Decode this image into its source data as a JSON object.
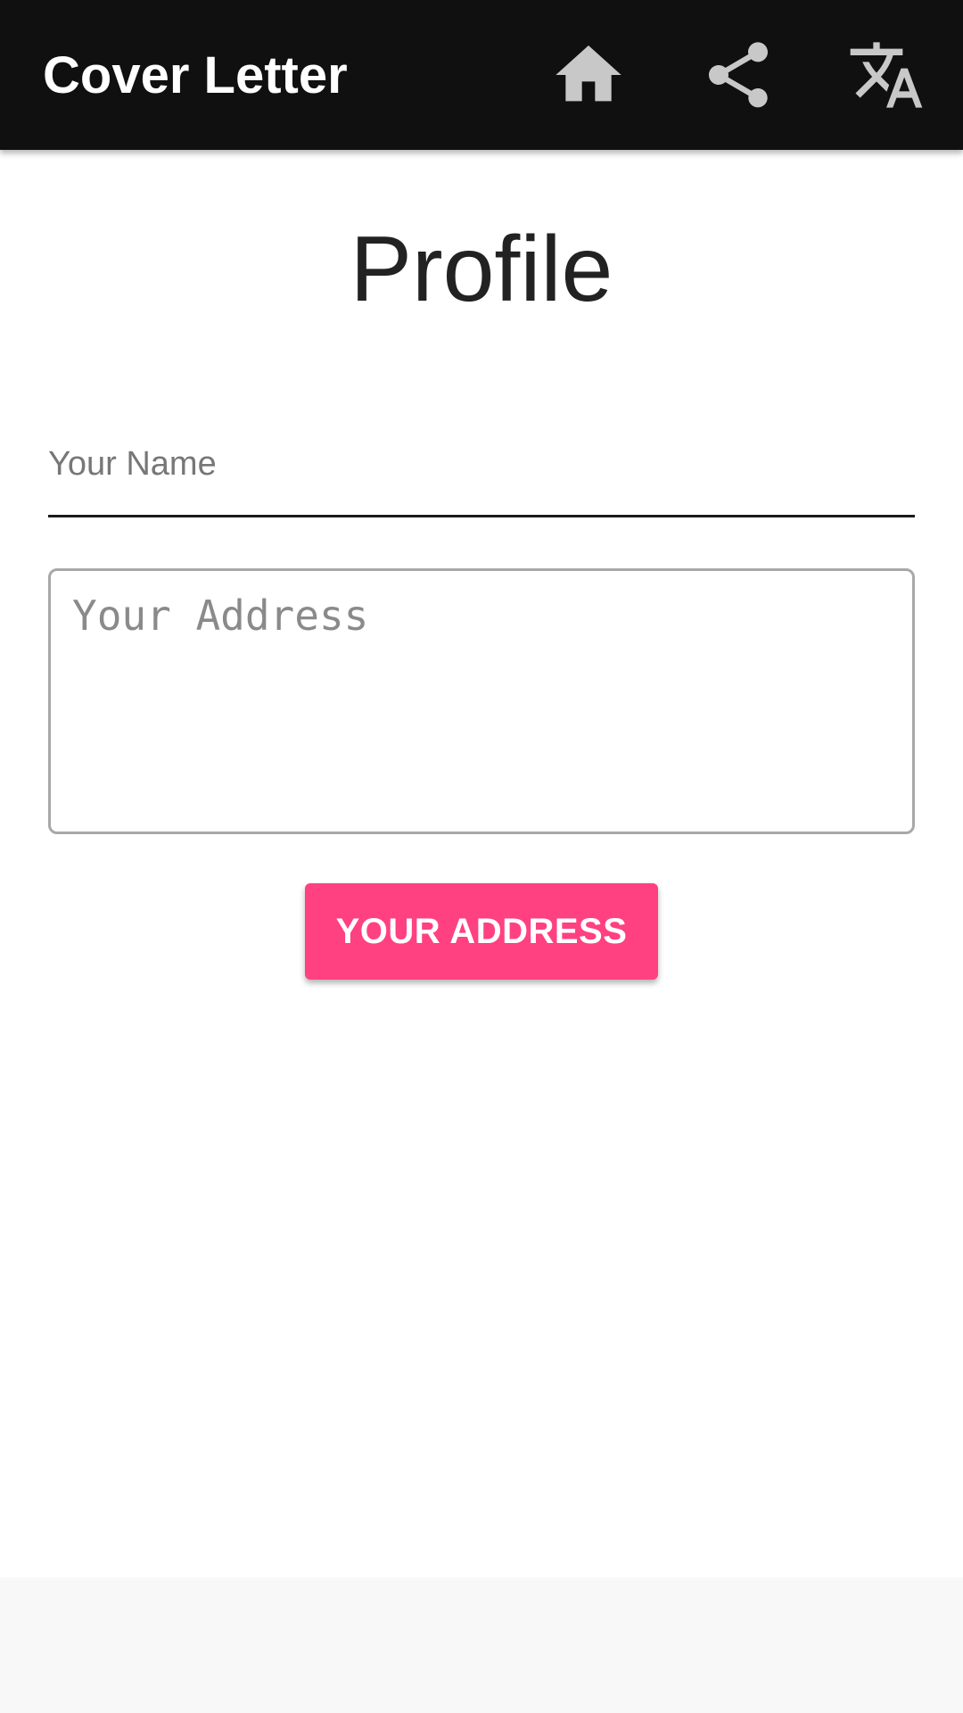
{
  "app_bar": {
    "title": "Cover Letter",
    "background": "#101010",
    "icon_color": "#c8c8c8",
    "icons": [
      "home-icon",
      "share-icon",
      "translate-icon"
    ]
  },
  "page": {
    "title": "Profile"
  },
  "form": {
    "name_placeholder": "Your Name",
    "address_placeholder": "Your Address",
    "button_label": "YOUR ADDRESS",
    "button_color": "#ff4081"
  }
}
